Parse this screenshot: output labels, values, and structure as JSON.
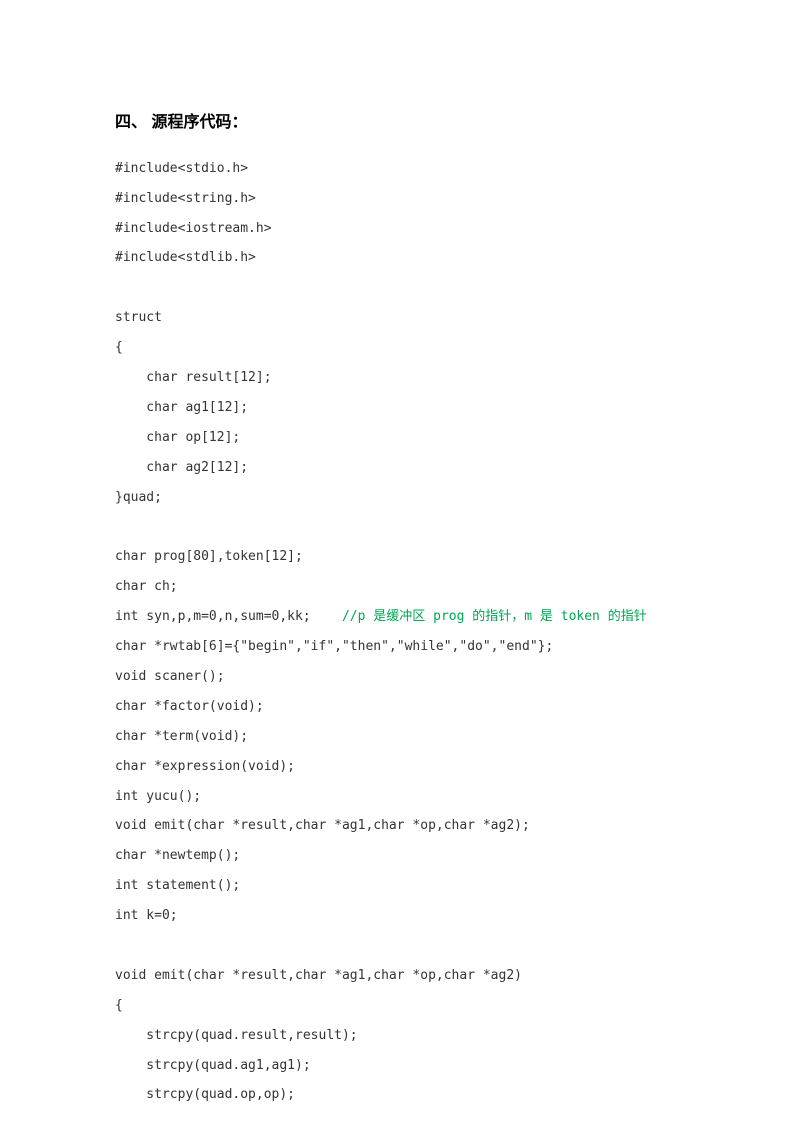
{
  "heading": "四、  源程序代码：",
  "code": {
    "line1": "#include<stdio.h>",
    "line2": "#include<string.h>",
    "line3": "#include<iostream.h>",
    "line4": "#include<stdlib.h>",
    "line5": "",
    "line6": "struct",
    "line7": "{",
    "line8": "    char result[12];",
    "line9": "    char ag1[12];",
    "line10": "    char op[12];",
    "line11": "    char ag2[12];",
    "line12": "}quad;",
    "line13": "",
    "line14": "char prog[80],token[12];",
    "line15": "char ch;",
    "line16_part1": "int syn,p,m=0,n,sum=0,kk;    ",
    "line16_comment_prefix": "//p 是缓冲区 ",
    "line16_prog": "prog",
    "line16_comment_mid": " 的指针，m 是 ",
    "line16_token": "token",
    "line16_comment_suffix": " 的指针",
    "line17": "char *rwtab[6]={\"begin\",\"if\",\"then\",\"while\",\"do\",\"end\"};",
    "line18": "void scaner();",
    "line19": "char *factor(void);",
    "line20": "char *term(void);",
    "line21": "char *expression(void);",
    "line22": "int yucu();",
    "line23": "void emit(char *result,char *ag1,char *op,char *ag2);",
    "line24": "char *newtemp();",
    "line25": "int statement();",
    "line26": "int k=0;",
    "line27": "",
    "line28": "void emit(char *result,char *ag1,char *op,char *ag2)",
    "line29": "{",
    "line30": "    strcpy(quad.result,result);",
    "line31": "    strcpy(quad.ag1,ag1);",
    "line32": "    strcpy(quad.op,op);"
  }
}
